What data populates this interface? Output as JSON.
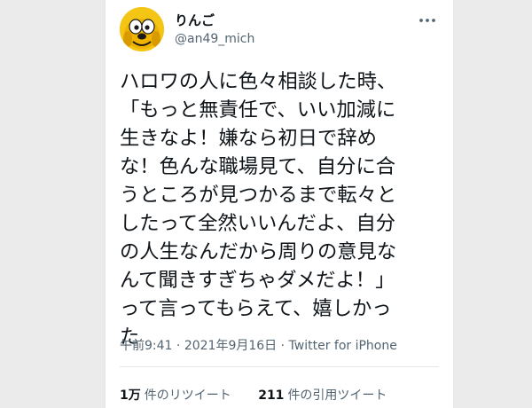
{
  "tweet": {
    "display_name": "りんご",
    "handle": "@an49_mich",
    "body_lines": [
      "ハロワの人に色々相談した時、",
      "「もっと無責任で、いい加減に",
      "生きなよ！嫌なら初日で辞め",
      "な！色んな職場見て、自分に合",
      "うところが見つかるまで転々と",
      "したって全然いいんだよ、自分",
      "の人生なんだから周りの意見な",
      "んて聞きすぎちゃダメだよ！」",
      "って言ってもらえて、嬉しかっ",
      "た"
    ],
    "time": "午前9:41",
    "separator": " · ",
    "date": "2021年9月16日",
    "source": "Twitter for iPhone",
    "retweets": {
      "count": "1万",
      "label": "件のリツイート"
    },
    "quotes": {
      "count": "211",
      "label": "件の引用ツイート"
    }
  },
  "icons": {
    "avatar": "cartoon-dog-avatar",
    "more": "more-options-icon"
  },
  "colors": {
    "text_primary": "#0f1419",
    "text_secondary": "#536471",
    "avatar_bg": "#f5c516"
  }
}
